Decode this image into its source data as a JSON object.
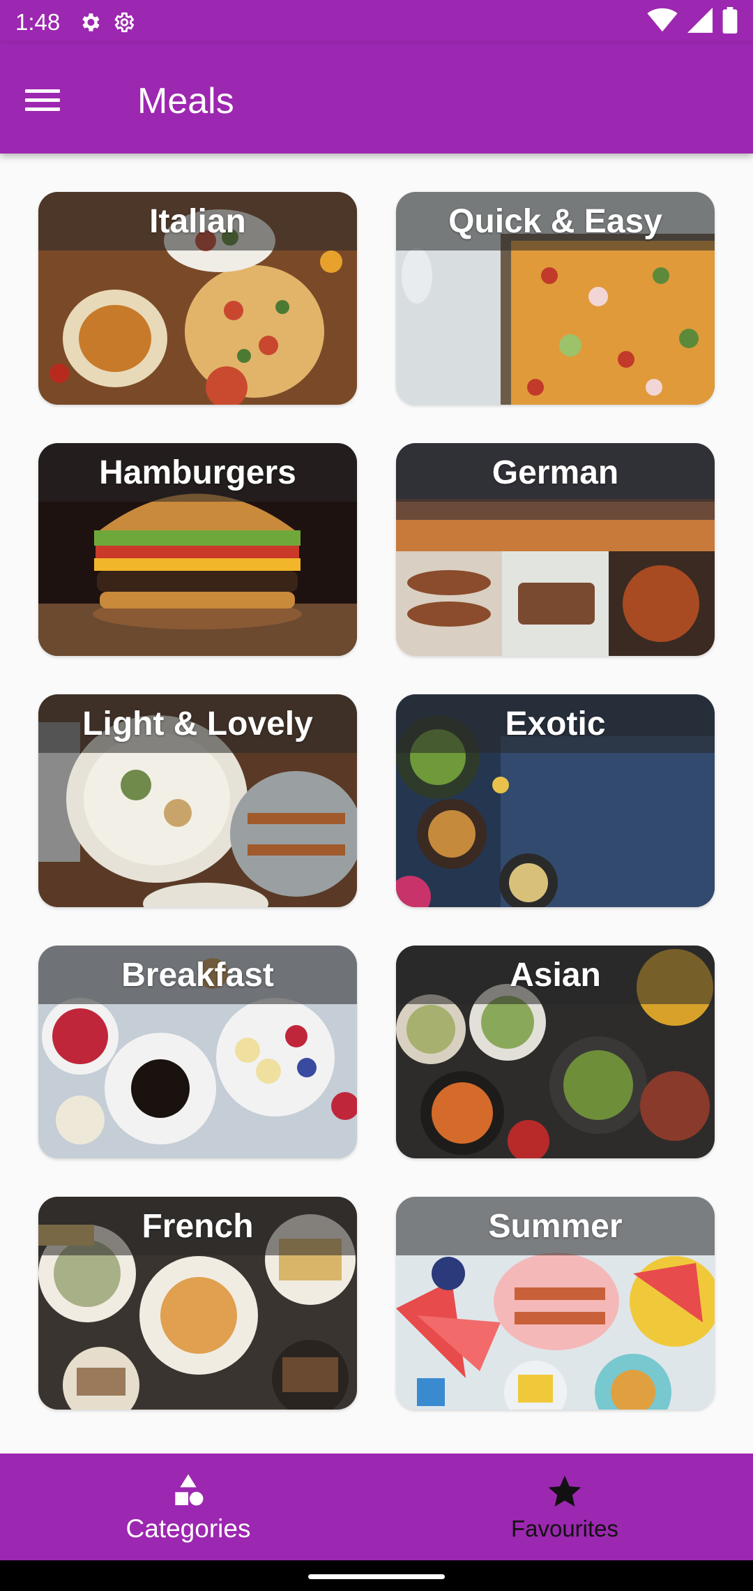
{
  "status_bar": {
    "time": "1:48",
    "icons": [
      "settings-gear-icon",
      "settings-gear-outline-icon",
      "wifi-icon",
      "cellular-signal-icon",
      "battery-icon"
    ]
  },
  "app_bar": {
    "title": "Meals",
    "menu_icon": "hamburger-menu-icon",
    "color": "#9c27b0"
  },
  "categories": [
    {
      "label": "Italian",
      "palette": [
        "#7a4a28",
        "#c9472f",
        "#e8d9b8"
      ]
    },
    {
      "label": "Quick & Easy",
      "palette": [
        "#d8dde0",
        "#d9762b",
        "#5d8a3a"
      ]
    },
    {
      "label": "Hamburgers",
      "palette": [
        "#1e1210",
        "#7a4b2a",
        "#d2a23c"
      ]
    },
    {
      "label": "German",
      "palette": [
        "#3b3a4a",
        "#c87a3a",
        "#8a4c2c"
      ]
    },
    {
      "label": "Light & Lovely",
      "palette": [
        "#5a3a26",
        "#e6e2d8",
        "#6f8a4a"
      ]
    },
    {
      "label": "Exotic",
      "palette": [
        "#1f2d45",
        "#324a6e",
        "#c58a3c"
      ]
    },
    {
      "label": "Breakfast",
      "palette": [
        "#c5cdd6",
        "#f2f2f2",
        "#c0263a"
      ]
    },
    {
      "label": "Asian",
      "palette": [
        "#2e2c2a",
        "#d46b2a",
        "#6e8e3a"
      ]
    },
    {
      "label": "French",
      "palette": [
        "#3a3430",
        "#d9b56a",
        "#f1ece2"
      ]
    },
    {
      "label": "Summer",
      "palette": [
        "#dfe6ea",
        "#e84b4b",
        "#f0c93a"
      ]
    }
  ],
  "bottom_nav": {
    "items": [
      {
        "label": "Categories",
        "icon": "categories-shapes-icon",
        "active": true
      },
      {
        "label": "Favourites",
        "icon": "star-icon",
        "active": false
      }
    ]
  }
}
